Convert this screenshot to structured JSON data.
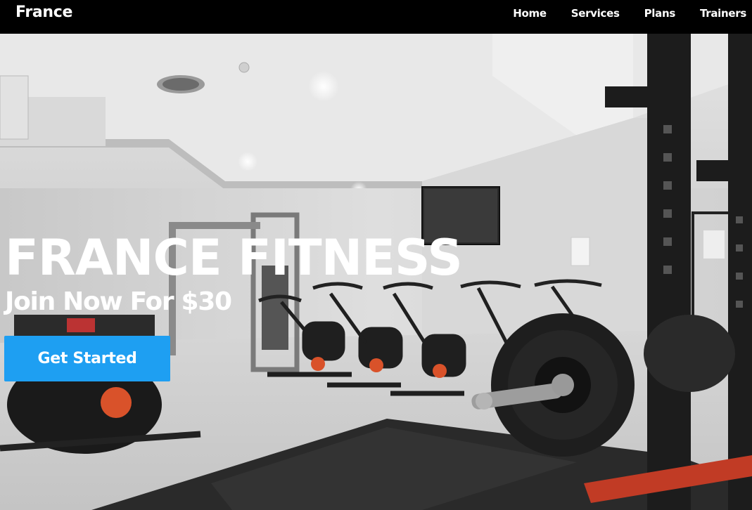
{
  "brand": {
    "name": "France"
  },
  "nav": {
    "items": [
      {
        "label": "Home"
      },
      {
        "label": "Services"
      },
      {
        "label": "Plans"
      },
      {
        "label": "Trainers"
      }
    ]
  },
  "hero": {
    "title": "FRANCE FITNESS",
    "subtitle": "Join Now For $30",
    "cta_label": "Get Started",
    "image_description": "gym-interior-photo"
  },
  "colors": {
    "nav_background": "#000000",
    "cta_background": "#1e9ff2",
    "text": "#ffffff"
  }
}
